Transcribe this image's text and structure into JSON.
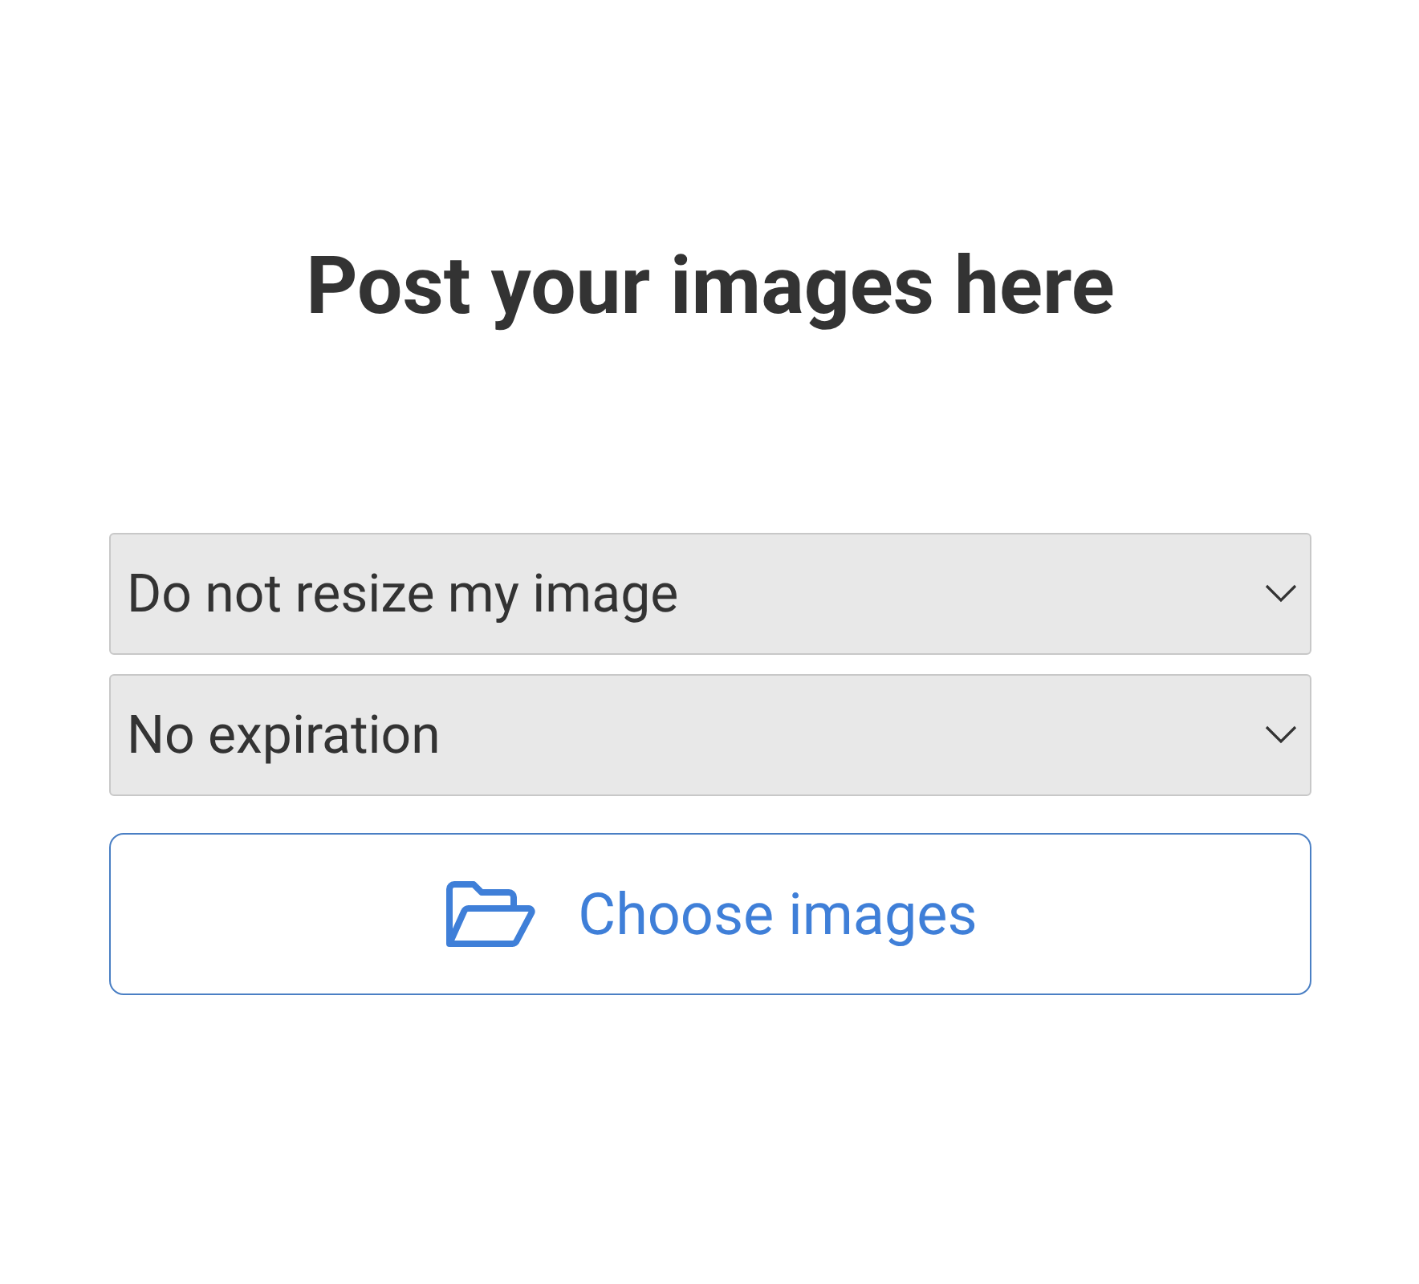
{
  "heading": "Post your images here",
  "selects": [
    {
      "value": "Do not resize my image"
    },
    {
      "value": "No expiration"
    }
  ],
  "upload_button": {
    "label": "Choose images"
  }
}
